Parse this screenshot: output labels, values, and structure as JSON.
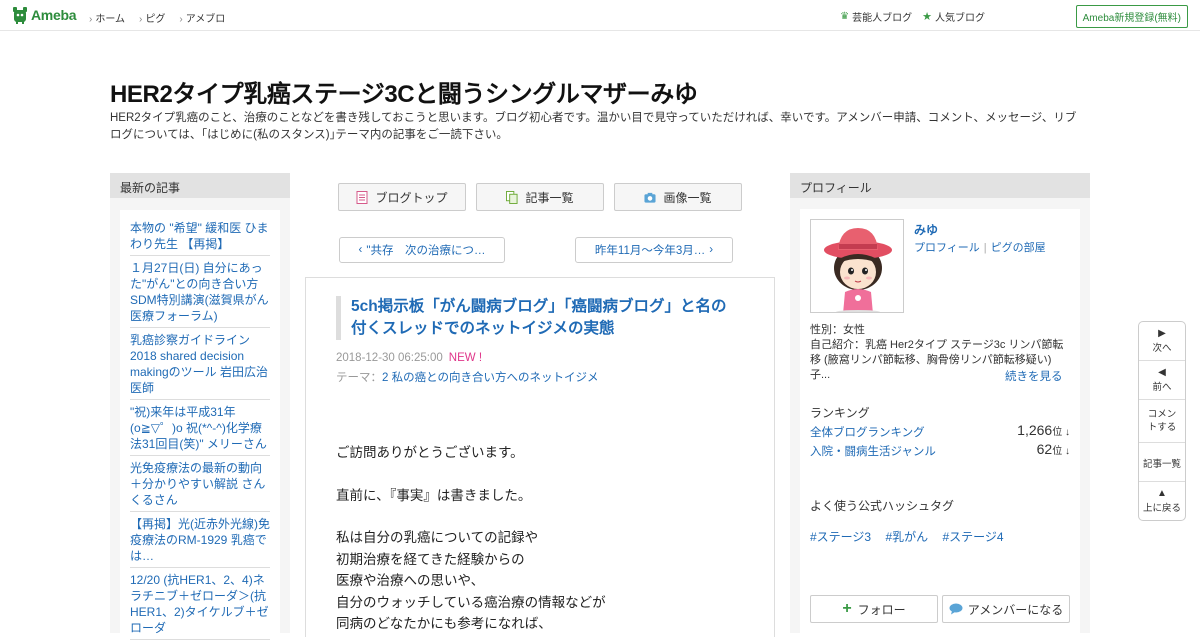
{
  "topbar": {
    "logo_text": "Ameba",
    "nav": [
      "ホーム",
      "ピグ",
      "アメブロ"
    ],
    "right_links": [
      "芸能人ブログ",
      "人気ブログ"
    ],
    "signup": "Ameba新規登録(無料)"
  },
  "header": {
    "title": "HER2タイプ乳癌ステージ3Cと闘うシングルマザーみゆ",
    "description": "HER2タイプ乳癌のこと、治療のことなどを書き残しておこうと思います。ブログ初心者です。温かい目で見守っていただければ、幸いです。アメンバー申請、コメント、メッセージ、リブログについては、｢はじめに(私のスタンス)｣テーマ内の記事をご一読下さい。"
  },
  "left": {
    "header": "最新の記事",
    "entries": [
      "本物の \"希望\" 緩和医 ひまわり先生 【再掲】",
      "１月27日(日) 自分にあった\"がん\"との向き合い方 SDM特別講演(滋賀県がん医療フォーラム)",
      "乳癌診察ガイドライン2018 shared decision makingのツール 岩田広治医師",
      "\"祝)来年は平成31年(o≧▽゜)o 祝(*^-^)化学療法31回目(笑)\" メリーさん",
      "光免疫療法の最新の動向＋分かりやすい解説 さんくるさん",
      "【再掲】光(近赤外光線)免疫療法のRM-1929 乳癌では…",
      "12/20 (抗HER1、2、4)ネラチニブ＋ゼローダ＞(抗HER1、2)タイケルブ＋ゼローダ"
    ]
  },
  "center": {
    "tabs": [
      "ブログトップ",
      "記事一覧",
      "画像一覧"
    ],
    "prev": "\"共存　次の治療につ…",
    "next": "昨年11月～今年3月…",
    "article": {
      "title": "5ch掲示板「がん闘病ブログ」「癌闘病ブログ」と名の付くスレッドでのネットイジメの実態",
      "date": "2018-12-30 06:25:00",
      "new_badge": "NEW !",
      "theme_label": "テーマ：",
      "theme": "2 私の癌との向き合い方へのネットイジメ",
      "body": [
        "ご訪問ありがとうございます。",
        "",
        "直前に、『事実』は書きました。",
        "",
        "私は自分の乳癌についての記録や",
        "初期治療を経てきた経験からの",
        "医療や治療への思いや、",
        "自分のウォッチしている癌治療の情報などが",
        "同病のどなたかにも参考になれば、"
      ]
    }
  },
  "right": {
    "header": "プロフィール",
    "name": "みゆ",
    "link_profile": "プロフィール",
    "link_pigg": "ピグの部屋",
    "gender": "性別：女性",
    "intro": "自己紹介：乳癌 Her2タイプ ステージ3c リンパ節転移 (腋窩リンパ節転移、胸骨傍リンパ節転移疑い) 子...",
    "more": "続きを見る",
    "ranking_title": "ランキング",
    "rankings": [
      {
        "label": "全体ブログランキング",
        "value": "1,266",
        "unit": "位 ↓"
      },
      {
        "label": "入院・闘病生活ジャンル",
        "value": "62",
        "unit": "位 ↓"
      }
    ],
    "hashtag_title": "よく使う公式ハッシュタグ",
    "hashtags": [
      "#ステージ3",
      "#乳がん",
      "#ステージ4"
    ],
    "follow": "フォロー",
    "amember": "アメンバーになる"
  },
  "floatnav": [
    "次へ",
    "前へ",
    "コメントする",
    "記事一覧",
    "上に戻る"
  ]
}
